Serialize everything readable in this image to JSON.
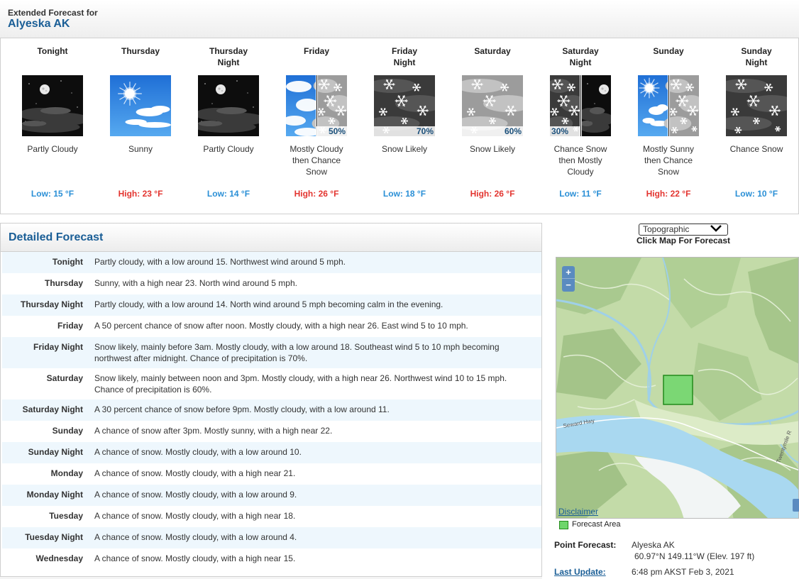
{
  "header": {
    "subtitle": "Extended Forecast for",
    "location": "Alyeska AK"
  },
  "periods": [
    {
      "name_line1": "Tonight",
      "name_line2": "",
      "icon": "partly-cloudy-night-icon",
      "short": [
        "Partly Cloudy"
      ],
      "temp": "Low: 15 °F",
      "temp_type": "low",
      "pop": ""
    },
    {
      "name_line1": "Thursday",
      "name_line2": "",
      "icon": "sunny-icon",
      "short": [
        "Sunny"
      ],
      "temp": "High: 23 °F",
      "temp_type": "high",
      "pop": ""
    },
    {
      "name_line1": "Thursday",
      "name_line2": "Night",
      "icon": "partly-cloudy-night-icon",
      "short": [
        "Partly Cloudy"
      ],
      "temp": "Low: 14 °F",
      "temp_type": "low",
      "pop": ""
    },
    {
      "name_line1": "Friday",
      "name_line2": "",
      "icon": "cloudy-then-snow-icon",
      "short": [
        "Mostly Cloudy",
        "then Chance",
        "Snow"
      ],
      "temp": "High: 26 °F",
      "temp_type": "high",
      "pop": "50%"
    },
    {
      "name_line1": "Friday",
      "name_line2": "Night",
      "icon": "snow-night-icon",
      "short": [
        "Snow Likely"
      ],
      "temp": "Low: 18 °F",
      "temp_type": "low",
      "pop": "70%"
    },
    {
      "name_line1": "Saturday",
      "name_line2": "",
      "icon": "snow-day-icon",
      "short": [
        "Snow Likely"
      ],
      "temp": "High: 26 °F",
      "temp_type": "high",
      "pop": "60%"
    },
    {
      "name_line1": "Saturday",
      "name_line2": "Night",
      "icon": "snow-then-cloudy-night-icon",
      "short": [
        "Chance Snow",
        "then Mostly",
        "Cloudy"
      ],
      "temp": "Low: 11 °F",
      "temp_type": "low",
      "pop": "30%"
    },
    {
      "name_line1": "Sunday",
      "name_line2": "",
      "icon": "sunny-then-snow-icon",
      "short": [
        "Mostly Sunny",
        "then Chance",
        "Snow"
      ],
      "temp": "High: 22 °F",
      "temp_type": "high",
      "pop": ""
    },
    {
      "name_line1": "Sunday",
      "name_line2": "Night",
      "icon": "snow-night-icon",
      "short": [
        "Chance Snow"
      ],
      "temp": "Low: 10 °F",
      "temp_type": "low",
      "pop": ""
    }
  ],
  "detailed": {
    "title": "Detailed Forecast",
    "rows": [
      {
        "label": "Tonight",
        "text": [
          "Partly cloudy, with a low around 15. Northwest wind around 5 mph."
        ]
      },
      {
        "label": "Thursday",
        "text": [
          "Sunny, with a high near 23. North wind around 5 mph."
        ]
      },
      {
        "label": "Thursday Night",
        "text": [
          "Partly cloudy, with a low around 14. North wind around 5 mph becoming calm in the evening."
        ]
      },
      {
        "label": "Friday",
        "text": [
          "A 50 percent chance of snow after noon. Mostly cloudy, with a high near 26. East wind 5 to 10 mph."
        ]
      },
      {
        "label": "Friday Night",
        "text": [
          "Snow likely, mainly before 3am. Mostly cloudy, with a low around 18. Southeast wind 5 to 10 mph becoming",
          "northwest after midnight. Chance of precipitation is 70%."
        ]
      },
      {
        "label": "Saturday",
        "text": [
          "Snow likely, mainly between noon and 3pm. Mostly cloudy, with a high near 26. Northwest wind 10 to 15 mph.",
          "Chance of precipitation is 60%."
        ]
      },
      {
        "label": "Saturday Night",
        "text": [
          "A 30 percent chance of snow before 9pm. Mostly cloudy, with a low around 11."
        ]
      },
      {
        "label": "Sunday",
        "text": [
          "A chance of snow after 3pm. Mostly sunny, with a high near 22."
        ]
      },
      {
        "label": "Sunday Night",
        "text": [
          "A chance of snow. Mostly cloudy, with a low around 10."
        ]
      },
      {
        "label": "Monday",
        "text": [
          "A chance of snow. Mostly cloudy, with a high near 21."
        ]
      },
      {
        "label": "Monday Night",
        "text": [
          "A chance of snow. Mostly cloudy, with a low around 9."
        ]
      },
      {
        "label": "Tuesday",
        "text": [
          "A chance of snow. Mostly cloudy, with a high near 18."
        ]
      },
      {
        "label": "Tuesday Night",
        "text": [
          "A chance of snow. Mostly cloudy, with a low around 4."
        ]
      },
      {
        "label": "Wednesday",
        "text": [
          "A chance of snow. Mostly cloudy, with a high near 15."
        ]
      }
    ]
  },
  "map": {
    "type_selected": "Topographic",
    "click_label": "Click Map For Forecast",
    "zoom_in": "+",
    "zoom_out": "−",
    "road_label": "Seward Hwy",
    "creek_label": "Twentymile R",
    "disclaimer": "Disclaimer",
    "legend_label": "Forecast Area"
  },
  "point": {
    "label": "Point Forecast:",
    "name": "Alyeska AK",
    "coords": "60.97°N 149.11°W (Elev. 197 ft)",
    "update_label": "Last Update:",
    "update_value": "6:48 pm AKST Feb 3, 2021"
  },
  "colors": {
    "brand_blue": "#1a5e96",
    "low_temp": "#2a8fd6",
    "high_temp": "#e3342f",
    "row_alt": "#eef7fd",
    "forecast_area": "#6ed66b"
  }
}
